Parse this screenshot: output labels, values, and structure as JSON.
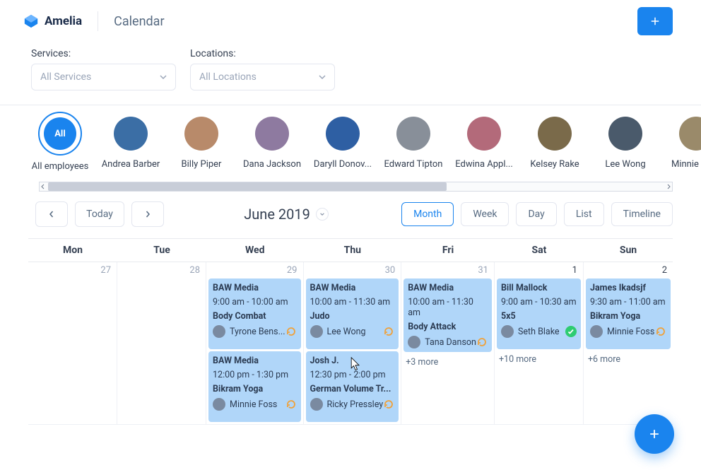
{
  "brand": {
    "name": "Amelia"
  },
  "page": {
    "title": "Calendar"
  },
  "filters": {
    "services": {
      "label": "Services:",
      "placeholder": "All Services"
    },
    "locations": {
      "label": "Locations:",
      "placeholder": "All Locations"
    }
  },
  "employees": {
    "all_label": "All",
    "all_caption": "All employees",
    "items": [
      {
        "name": "Andrea Barber"
      },
      {
        "name": "Billy Piper"
      },
      {
        "name": "Dana Jackson"
      },
      {
        "name": "Daryll Donov..."
      },
      {
        "name": "Edward Tipton"
      },
      {
        "name": "Edwina Appl..."
      },
      {
        "name": "Kelsey Rake"
      },
      {
        "name": "Lee Wong"
      },
      {
        "name": "Minnie Foss"
      }
    ]
  },
  "toolbar": {
    "today": "Today",
    "month_label": "June 2019",
    "views": [
      "Month",
      "Week",
      "Day",
      "List",
      "Timeline"
    ],
    "active_view": "Month"
  },
  "calendar": {
    "day_names": [
      "Mon",
      "Tue",
      "Wed",
      "Thu",
      "Fri",
      "Sat",
      "Sun"
    ],
    "dates": [
      {
        "n": "27",
        "in": false
      },
      {
        "n": "28",
        "in": false
      },
      {
        "n": "29",
        "in": false
      },
      {
        "n": "30",
        "in": false
      },
      {
        "n": "31",
        "in": false
      },
      {
        "n": "1",
        "in": true
      },
      {
        "n": "2",
        "in": true
      }
    ],
    "events": {
      "wed": [
        {
          "client": "BAW Media",
          "time": "9:00 am - 10:00 am",
          "service": "Body Combat",
          "person": "Tyrone Bens...",
          "status": "reschedule"
        },
        {
          "client": "BAW Media",
          "time": "12:00 pm - 1:30 pm",
          "service": "Bikram Yoga",
          "person": "Minnie Foss",
          "status": "reschedule"
        }
      ],
      "thu": [
        {
          "client": "BAW Media",
          "time": "10:00 am - 11:30 am",
          "service": "Judo",
          "person": "Lee Wong",
          "status": "reschedule"
        },
        {
          "client": "Josh J.",
          "time": "12:30 pm - 2:00 pm",
          "service": "German Volume Tr...",
          "person": "Ricky Pressley",
          "status": "reschedule"
        }
      ],
      "fri": [
        {
          "client": "BAW Media",
          "time": "10:00 am - 11:30 am",
          "service": "Body Attack",
          "person": "Tana Danson",
          "status": "reschedule"
        }
      ],
      "sat": [
        {
          "client": "Bill Mallock",
          "time": "9:00 am - 10:30 am",
          "service": "5x5",
          "person": "Seth Blake",
          "status": "approved"
        }
      ],
      "sun": [
        {
          "client": "James Ikadsjf",
          "time": "9:30 am - 11:00 am",
          "service": "Bikram Yoga",
          "person": "Minnie Foss",
          "status": "reschedule"
        }
      ]
    },
    "more": {
      "fri": "+3 more",
      "sat": "+10 more",
      "sun": "+6 more"
    }
  }
}
